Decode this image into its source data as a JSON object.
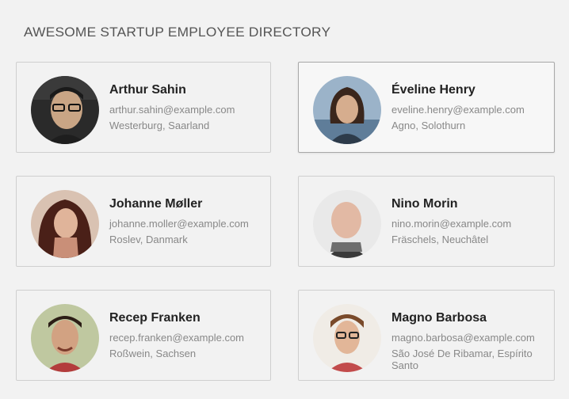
{
  "directory": {
    "title": "AWESOME STARTUP EMPLOYEE DIRECTORY",
    "employees": [
      {
        "name": "Arthur Sahin",
        "email": "arthur.sahin@example.com",
        "location": "Westerburg, Saarland"
      },
      {
        "name": "Éveline Henry",
        "email": "eveline.henry@example.com",
        "location": "Agno, Solothurn"
      },
      {
        "name": "Johanne Møller",
        "email": "johanne.moller@example.com",
        "location": "Roslev, Danmark"
      },
      {
        "name": "Nino Morin",
        "email": "nino.morin@example.com",
        "location": "Fräschels, Neuchâtel"
      },
      {
        "name": "Recep Franken",
        "email": "recep.franken@example.com",
        "location": "Roßwein, Sachsen"
      },
      {
        "name": "Magno Barbosa",
        "email": "magno.barbosa@example.com",
        "location": "São José De Ribamar, Espírito Santo"
      }
    ]
  }
}
